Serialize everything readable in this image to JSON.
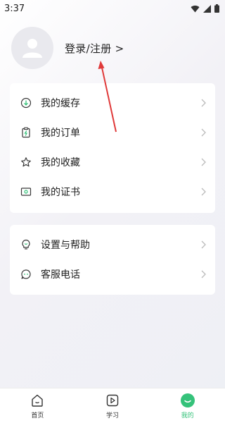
{
  "status": {
    "time": "3:37"
  },
  "profile": {
    "login_label": "登录/注册 >"
  },
  "menu_group_1": [
    {
      "label": "我的缓存",
      "icon": "download-icon"
    },
    {
      "label": "我的订单",
      "icon": "order-icon"
    },
    {
      "label": "我的收藏",
      "icon": "star-icon"
    },
    {
      "label": "我的证书",
      "icon": "certificate-icon"
    }
  ],
  "menu_group_2": [
    {
      "label": "设置与帮助",
      "icon": "lightbulb-icon"
    },
    {
      "label": "客服电话",
      "icon": "chat-icon"
    }
  ],
  "bottom_nav": [
    {
      "label": "首页",
      "icon": "home-icon",
      "active": false
    },
    {
      "label": "学习",
      "icon": "play-icon",
      "active": false
    },
    {
      "label": "我的",
      "icon": "profile-icon",
      "active": true
    }
  ],
  "colors": {
    "accent": "#35c27a",
    "annotation": "#e03a3a"
  }
}
